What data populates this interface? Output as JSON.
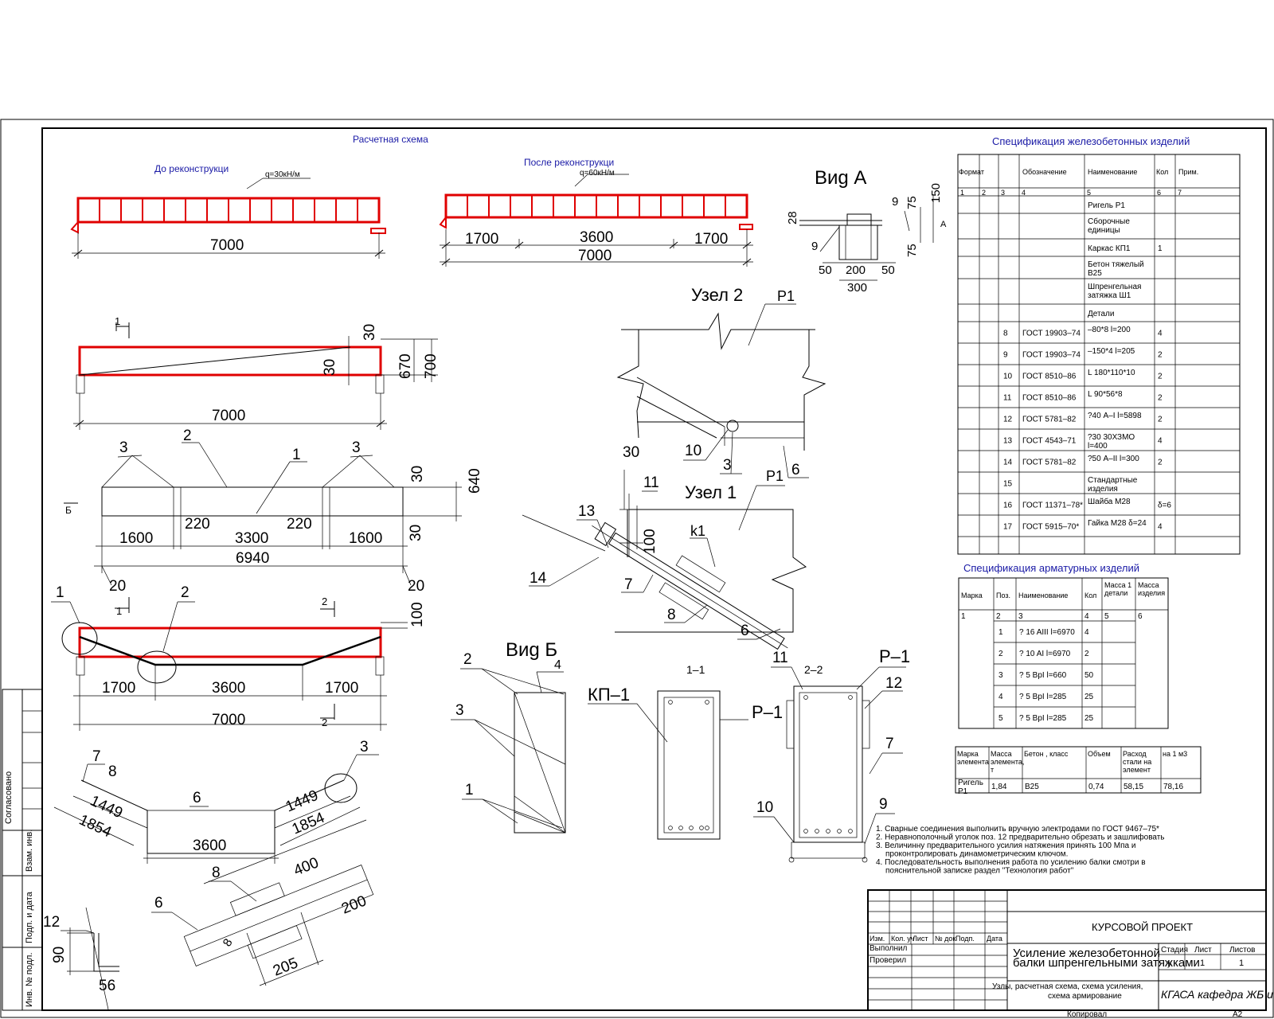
{
  "titles": {
    "calc_scheme": "Расчетная схема",
    "before": "До реконструкци",
    "after": "После реконструкци",
    "load_before": "q=30кН/м",
    "load_after": "q=60кН/м",
    "view_a": "Виg А",
    "view_b": "Виg Б",
    "node2": "Узел 2",
    "node2_tag": "Р1",
    "node1": "Узел 1",
    "node1_tag": "Р1",
    "k1": "k1",
    "kp1": "КП–1",
    "p1_left": "Р–1",
    "p1_right": "Р–1",
    "sec11": "1–1",
    "sec22": "2–2",
    "spec_rc_title": "Спецификация железобетонных изделий",
    "spec_reb_title": "Спецификация   арматурных изделий"
  },
  "dims": {
    "d7000a": "7000",
    "d1700a": "1700",
    "d3600a": "3600",
    "d1700b": "1700",
    "d7000b": "7000",
    "d28": "28",
    "d9a": "9",
    "d75a": "75",
    "d150": "150",
    "d75b": "75",
    "dA": "А",
    "d9b": "9",
    "d50a": "50",
    "d200": "200",
    "d50b": "50",
    "d300": "300",
    "s1": "1",
    "d30a": "30",
    "d30b": "30",
    "d670": "670",
    "d700": "700",
    "d7000c": "7000",
    "n3a": "3",
    "n2a": "2",
    "n1a": "1",
    "n3b": "3",
    "d30c": "30",
    "d640": "640",
    "dB": "Б",
    "d1600a": "1600",
    "d220a": "220",
    "d3300": "3300",
    "d220b": "220",
    "d1600b": "1600",
    "d30d": "30",
    "d6940": "6940",
    "d20a": "20",
    "d20b": "20",
    "s1b": "1",
    "n1b": "1",
    "n2b": "2",
    "s2a": "2",
    "d100a": "100",
    "d1700c": "1700",
    "d3600b": "3600",
    "d1700d": "1700",
    "d7000d": "7000",
    "s2b": "2",
    "n7a": "7",
    "n8a": "8",
    "n6a": "6",
    "n3c": "3",
    "d1449a": "1449",
    "d1449b": "1449",
    "d1854a": "1854",
    "d1854b": "1854",
    "d3600c": "3600",
    "n6b": "6",
    "n8b": "8",
    "d400": "400",
    "d200b": "200",
    "d8": "8",
    "d205": "205",
    "n12a": "12",
    "d90": "90",
    "d56": "56",
    "n30": "30",
    "n10": "10",
    "n3d": "3",
    "n6c": "6",
    "n11a": "11",
    "n13": "13",
    "d100b": "100",
    "n14": "14",
    "n7b": "7",
    "n8c": "8",
    "n6d": "6",
    "n2c": "2",
    "n4": "4",
    "n3e": "3",
    "n1c": "1",
    "n11b": "11",
    "n12b": "12",
    "n7c": "7",
    "n10b": "10",
    "n9": "9"
  },
  "spec_rc": {
    "headers": [
      "Формат",
      "",
      "",
      "Обозначение",
      "Наименование",
      "Кол",
      "Прим."
    ],
    "numbers": [
      "1",
      "2",
      "3",
      "4",
      "5",
      "6",
      "7"
    ],
    "rows": [
      {
        "pos": "",
        "desig": "",
        "name": "Ригель Р1",
        "qty": "",
        "note": ""
      },
      {
        "pos": "",
        "desig": "",
        "name": "Сборочные единицы",
        "qty": "",
        "note": ""
      },
      {
        "pos": "",
        "desig": "",
        "name": "Каркас КП1",
        "qty": "1",
        "note": ""
      },
      {
        "pos": "",
        "desig": "",
        "name": "Бетон тяжелый В25",
        "qty": "",
        "note": ""
      },
      {
        "pos": "",
        "desig": "",
        "name": "Шпренгельная затяжка Ш1",
        "qty": "",
        "note": ""
      },
      {
        "pos": "",
        "desig": "",
        "name": "Детали",
        "qty": "",
        "note": ""
      },
      {
        "pos": "8",
        "desig": "ГОСТ 19903–74",
        "name": "–80*8      l=200",
        "qty": "4",
        "note": ""
      },
      {
        "pos": "9",
        "desig": "ГОСТ 19903–74",
        "name": "–150*4   l=205",
        "qty": "2",
        "note": ""
      },
      {
        "pos": "10",
        "desig": "ГОСТ 8510–86",
        "name": "L 180*110*10",
        "qty": "2",
        "note": ""
      },
      {
        "pos": "11",
        "desig": "ГОСТ 8510–86",
        "name": "L 90*56*8",
        "qty": "2",
        "note": ""
      },
      {
        "pos": "12",
        "desig": "ГОСТ 5781–82",
        "name": "?40 А–I    l=5898",
        "qty": "2",
        "note": ""
      },
      {
        "pos": "13",
        "desig": "ГОСТ 4543–71",
        "name": "?30  30ХЗМО l=400",
        "qty": "4",
        "note": ""
      },
      {
        "pos": "14",
        "desig": "ГОСТ 5781–82",
        "name": "?50  А–II   l=300",
        "qty": "2",
        "note": ""
      },
      {
        "pos": "15",
        "desig": "",
        "name": "Стандартные изделия",
        "qty": "",
        "note": ""
      },
      {
        "pos": "16",
        "desig": "ГОСТ 11371–78*",
        "name": "Шайба М28",
        "qty": "δ=6",
        "note": ""
      },
      {
        "pos": "17",
        "desig": "ГОСТ 5915–70*",
        "name": "Гайка М28   δ=24",
        "qty": "4",
        "note": ""
      },
      {
        "pos": "",
        "desig": "",
        "name": "",
        "qty": "",
        "note": ""
      }
    ]
  },
  "spec_reb": {
    "headers": [
      "Марка",
      "Поз.",
      "Наименование",
      "Кол",
      "Масса 1 детали",
      "Масса изделия"
    ],
    "numbers": [
      "1",
      "2",
      "3",
      "4",
      "5",
      "6"
    ],
    "rows": [
      {
        "pos": "1",
        "name": "? 16  AIII l=6970",
        "qty": "4"
      },
      {
        "pos": "2",
        "name": "? 10   AI  l=6970",
        "qty": "2"
      },
      {
        "pos": "3",
        "name": "? 5  ВрI   l=660",
        "qty": "50"
      },
      {
        "pos": "4",
        "name": "?  5   ВрI   l=285",
        "qty": "25"
      },
      {
        "pos": "5",
        "name": "?  5   ВрI   l=285",
        "qty": "25"
      }
    ]
  },
  "mass_table": {
    "headers": [
      "Марка элемента",
      "Масса элемента, т",
      "Бетон ,  класс",
      "Объем",
      "Расход стали на элемент",
      "на 1  м3"
    ],
    "row": [
      "Ригель Р1",
      "1,84",
      "В25",
      "0,74",
      "58,15",
      "78,16"
    ]
  },
  "notes": [
    "1.  Сварные соединения выполнить вручную электродами по ГОСТ 9467–75*",
    "2.  Неравнополочный уголок поз. 12 предварительно обрезать и зашлифовать",
    "3.  Величинну предварительного усилия натяжения принять 100  Мпа и",
    "проконтролировать динамометрическим ключом.",
    "4.  Последовательность выполнения работа по усилению балки смотри в",
    "пояснительной записке раздел \"Технология работ\""
  ],
  "title_block": {
    "project": "КУРСОВОЙ  ПРОЕКТ",
    "title_l1": "Усиление  железобетонной",
    "title_l2": "балки   шпренгельными затяжками",
    "sheet_desc_l1": "Узлы,  расчетная схема,  схема усиления,",
    "sheet_desc_l2": "схема армирование",
    "org": "КГАСА кафедра ЖБ и",
    "stage": "Стадия",
    "sheet": "Лист",
    "sheets": "Листов",
    "stage_val": "у",
    "sheet_val": "1",
    "sheets_val": "1",
    "cols": [
      "Изм.",
      "Кол. уч",
      "Лист",
      "№ док",
      "Подп.",
      "Дата"
    ],
    "performed": "Выполнил",
    "checked": "Проверил",
    "copied": "Копировал",
    "format": "А2"
  },
  "side_stamps": {
    "agreed": "Согласовано",
    "inv_repl": "Взам. инв.",
    "sign_date": "Подп. и дата",
    "inv_orig": "Инв. № подл."
  }
}
